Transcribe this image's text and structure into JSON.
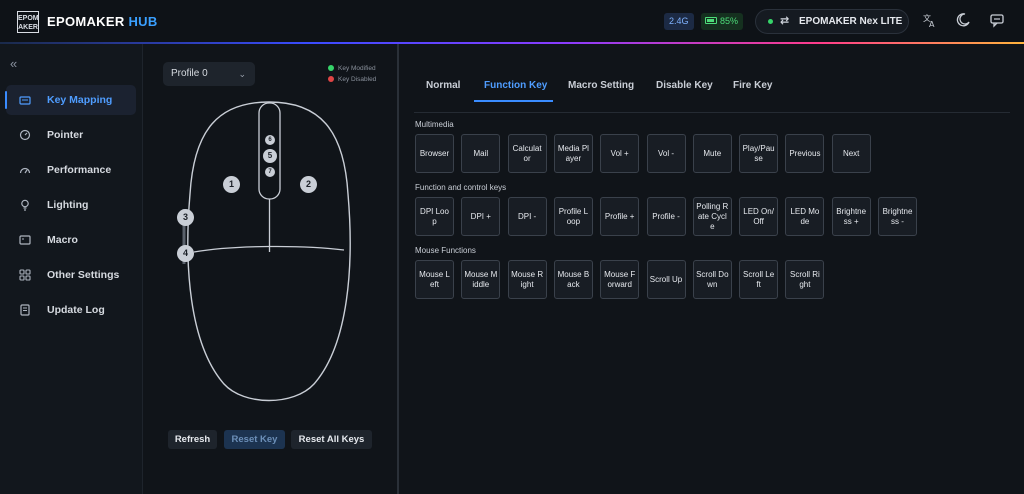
{
  "header": {
    "logo_text": "EPOM\nAKER",
    "brand_main": "EPOMAKER",
    "brand_accent": "HUB",
    "connection_badge": "2.4G",
    "battery_level": "85%",
    "device_name": "EPOMAKER Nex LITE"
  },
  "sidebar": {
    "items": [
      {
        "label": "Key Mapping",
        "icon": "keyboard-icon"
      },
      {
        "label": "Pointer",
        "icon": "gauge-icon"
      },
      {
        "label": "Performance",
        "icon": "speedometer-icon"
      },
      {
        "label": "Lighting",
        "icon": "bulb-icon"
      },
      {
        "label": "Macro",
        "icon": "macro-icon"
      },
      {
        "label": "Other Settings",
        "icon": "settings-icon"
      },
      {
        "label": "Update Log",
        "icon": "document-icon"
      }
    ]
  },
  "mouse_panel": {
    "profile": "Profile 0",
    "legend_modified": "Key Modified",
    "legend_disabled": "Key Disabled",
    "keys": [
      "1",
      "2",
      "3",
      "4",
      "5",
      "6",
      "7"
    ],
    "refresh_label": "Refresh",
    "reset_key_label": "Reset Key",
    "reset_all_label": "Reset All Keys"
  },
  "tabs": [
    "Normal",
    "Function Key",
    "Macro Setting",
    "Disable Key",
    "Fire Key"
  ],
  "sections": {
    "multimedia": {
      "title": "Multimedia",
      "keys": [
        "Browser",
        "Mail",
        "Calculator",
        "Media Player",
        "Vol +",
        "Vol -",
        "Mute",
        "Play/Pause",
        "Previous",
        "Next"
      ]
    },
    "function": {
      "title": "Function and control keys",
      "keys": [
        "DPI Loop",
        "DPI +",
        "DPI -",
        "Profile Loop",
        "Profile +",
        "Profile -",
        "Polling Rate Cycle",
        "LED On/Off",
        "LED Mode",
        "Brightness +",
        "Brightness -"
      ]
    },
    "mouse": {
      "title": "Mouse Functions",
      "keys": [
        "Mouse Left",
        "Mouse Middle",
        "Mouse Right",
        "Mouse Back",
        "Mouse Forward",
        "Scroll Up",
        "Scroll Down",
        "Scroll Left",
        "Scroll Right"
      ]
    }
  },
  "colors": {
    "accent": "#3a8cff",
    "modified": "#36d46a",
    "disabled": "#e04545"
  }
}
